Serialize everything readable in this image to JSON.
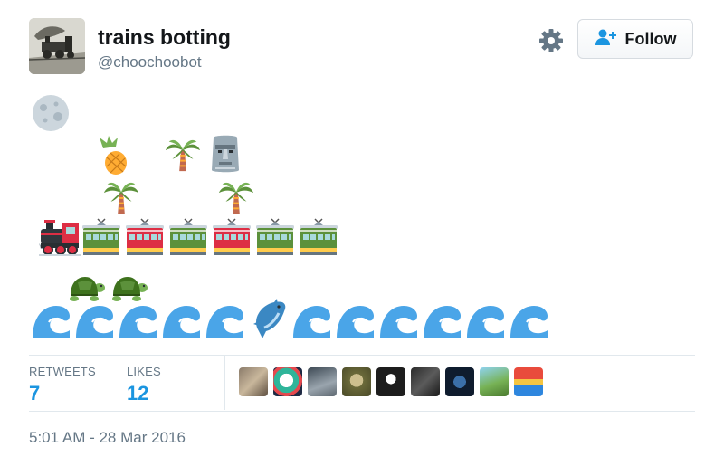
{
  "tweet": {
    "display_name": "trains botting",
    "handle": "@choochoobot",
    "follow_label": "Follow",
    "emoji_rows": {
      "sky": [
        "moon"
      ],
      "island_top": [
        "pineapple",
        "palm-tree",
        "moai"
      ],
      "island_bottom": [
        "palm-tree",
        "palm-tree"
      ],
      "train": [
        "locomotive",
        "tram-car-green",
        "tram-car-red",
        "tram-car-green",
        "tram-car-red",
        "tram-car-green",
        "tram-car-green"
      ],
      "turtles": [
        "turtle",
        "turtle"
      ],
      "sea": [
        "wave",
        "wave",
        "wave",
        "wave",
        "wave",
        "dolphin",
        "wave",
        "wave",
        "wave",
        "wave",
        "wave",
        "wave"
      ]
    },
    "stats": {
      "retweets_label": "RETWEETS",
      "retweets_value": "7",
      "likes_label": "LIKES",
      "likes_value": "12"
    },
    "likers": [
      "liker-avatar-1",
      "liker-avatar-2",
      "liker-avatar-3",
      "liker-avatar-4",
      "liker-avatar-5",
      "liker-avatar-6",
      "liker-avatar-7",
      "liker-avatar-8",
      "liker-avatar-9"
    ],
    "timestamp": "5:01 AM - 28 Mar 2016"
  },
  "colors": {
    "accent": "#1b95e0",
    "text": "#14171a",
    "muted": "#657786",
    "border": "#e1e8ed"
  }
}
